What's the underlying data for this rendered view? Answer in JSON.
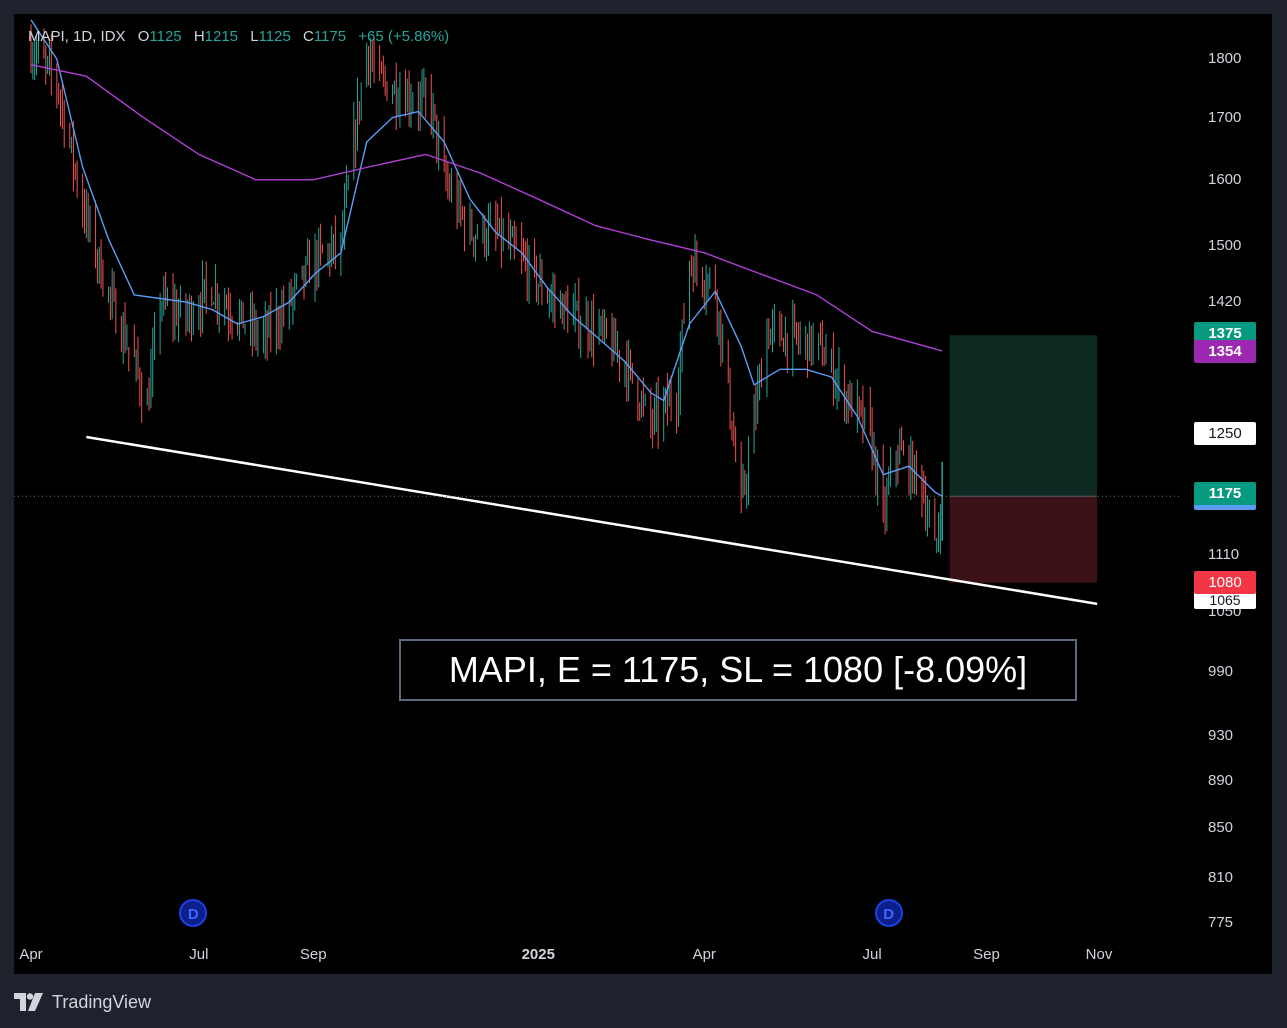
{
  "legend": {
    "symbol": "MAPI, 1D, IDX",
    "open_label": "O",
    "open": "1125",
    "high_label": "H",
    "high": "1215",
    "low_label": "L",
    "low": "1125",
    "close_label": "C",
    "close": "1175",
    "change": "+65 (+5.86%)"
  },
  "note": "MAPI, E = 1175, SL = 1080 [-8.09%]",
  "footer": {
    "brand": "TradingView",
    "logo_icon": "tradingview-logo-icon"
  },
  "colors": {
    "background": "#000000",
    "frame": "#1e222d",
    "up": "#26a69a",
    "down": "#ef5350",
    "ma_fast": "#5b9cf6",
    "ma_slow": "#b03fd6",
    "target_zone": "#0c2a22",
    "stop_zone": "#3a1117"
  },
  "price_tags": {
    "t1375": "1375",
    "t1354": "1354",
    "t1250": "1250",
    "t1175": "1175",
    "t1080": "1080",
    "t1065": "1065"
  },
  "dividend_markers": [
    {
      "label": "D",
      "date": "2024-06-28"
    },
    {
      "label": "D",
      "date": "2025-07-10"
    }
  ],
  "chart_data": {
    "type": "candlestick",
    "symbol": "MAPI",
    "timeframe": "1D",
    "exchange": "IDX",
    "title": "",
    "xlabel": "",
    "ylabel": "",
    "y_scale": "log",
    "ylim": [
      750,
      1900
    ],
    "y_ticks": [
      775,
      810,
      850,
      890,
      930,
      990,
      1050,
      1110,
      1185,
      1250,
      1345,
      1420,
      1500,
      1600,
      1700,
      1800
    ],
    "x_ticks": [
      {
        "label": "Apr",
        "date": "2024-04-01"
      },
      {
        "label": "Jul",
        "date": "2024-07-01"
      },
      {
        "label": "Sep",
        "date": "2024-09-01"
      },
      {
        "label": "2025",
        "date": "2025-01-01"
      },
      {
        "label": "Apr",
        "date": "2025-04-01"
      },
      {
        "label": "Jul",
        "date": "2025-07-01"
      },
      {
        "label": "Sep",
        "date": "2025-09-01"
      },
      {
        "label": "Nov",
        "date": "2025-11-01"
      }
    ],
    "xlim": [
      "2024-04-01",
      "2025-11-20"
    ],
    "last_bar": {
      "date": "2025-08-08",
      "open": 1125,
      "high": 1215,
      "low": 1125,
      "close": 1175
    },
    "price_path": [
      [
        "2024-04-01",
        1820
      ],
      [
        "2024-04-15",
        1760
      ],
      [
        "2024-04-29",
        1560
      ],
      [
        "2024-05-13",
        1430
      ],
      [
        "2024-05-27",
        1340
      ],
      [
        "2024-06-03",
        1280
      ],
      [
        "2024-06-10",
        1420
      ],
      [
        "2024-06-24",
        1400
      ],
      [
        "2024-07-08",
        1440
      ],
      [
        "2024-07-22",
        1400
      ],
      [
        "2024-08-05",
        1370
      ],
      [
        "2024-08-19",
        1420
      ],
      [
        "2024-09-02",
        1480
      ],
      [
        "2024-09-16",
        1500
      ],
      [
        "2024-09-23",
        1660
      ],
      [
        "2024-09-30",
        1820
      ],
      [
        "2024-10-07",
        1760
      ],
      [
        "2024-10-21",
        1740
      ],
      [
        "2024-11-04",
        1720
      ],
      [
        "2024-11-11",
        1600
      ],
      [
        "2024-11-25",
        1520
      ],
      [
        "2024-12-09",
        1520
      ],
      [
        "2024-12-23",
        1480
      ],
      [
        "2025-01-06",
        1430
      ],
      [
        "2025-01-20",
        1400
      ],
      [
        "2025-02-03",
        1380
      ],
      [
        "2025-02-17",
        1340
      ],
      [
        "2025-03-03",
        1260
      ],
      [
        "2025-03-17",
        1300
      ],
      [
        "2025-03-24",
        1480
      ],
      [
        "2025-04-07",
        1440
      ],
      [
        "2025-04-14",
        1300
      ],
      [
        "2025-04-21",
        1160
      ],
      [
        "2025-05-05",
        1380
      ],
      [
        "2025-05-19",
        1370
      ],
      [
        "2025-06-02",
        1360
      ],
      [
        "2025-06-16",
        1300
      ],
      [
        "2025-06-30",
        1250
      ],
      [
        "2025-07-07",
        1150
      ],
      [
        "2025-07-14",
        1230
      ],
      [
        "2025-07-28",
        1190
      ],
      [
        "2025-08-04",
        1110
      ],
      [
        "2025-08-08",
        1175
      ]
    ],
    "series": [
      {
        "kind": "moving_average_fast",
        "values": [
          [
            "2024-04-01",
            1870
          ],
          [
            "2024-04-15",
            1800
          ],
          [
            "2024-04-29",
            1620
          ],
          [
            "2024-05-13",
            1510
          ],
          [
            "2024-05-27",
            1430
          ],
          [
            "2024-06-10",
            1425
          ],
          [
            "2024-06-24",
            1420
          ],
          [
            "2024-07-08",
            1410
          ],
          [
            "2024-07-22",
            1390
          ],
          [
            "2024-08-05",
            1400
          ],
          [
            "2024-08-19",
            1420
          ],
          [
            "2024-09-02",
            1460
          ],
          [
            "2024-09-16",
            1490
          ],
          [
            "2024-09-30",
            1660
          ],
          [
            "2024-10-14",
            1700
          ],
          [
            "2024-10-28",
            1710
          ],
          [
            "2024-11-11",
            1660
          ],
          [
            "2024-11-25",
            1570
          ],
          [
            "2024-12-09",
            1520
          ],
          [
            "2024-12-23",
            1490
          ],
          [
            "2025-01-06",
            1440
          ],
          [
            "2025-01-20",
            1400
          ],
          [
            "2025-02-03",
            1370
          ],
          [
            "2025-02-17",
            1340
          ],
          [
            "2025-03-03",
            1300
          ],
          [
            "2025-03-10",
            1290
          ],
          [
            "2025-03-24",
            1390
          ],
          [
            "2025-04-07",
            1435
          ],
          [
            "2025-04-21",
            1360
          ],
          [
            "2025-04-28",
            1310
          ],
          [
            "2025-05-12",
            1330
          ],
          [
            "2025-05-26",
            1330
          ],
          [
            "2025-06-09",
            1320
          ],
          [
            "2025-06-23",
            1270
          ],
          [
            "2025-07-07",
            1200
          ],
          [
            "2025-07-21",
            1210
          ],
          [
            "2025-08-04",
            1180
          ],
          [
            "2025-08-08",
            1175
          ]
        ]
      },
      {
        "kind": "moving_average_slow",
        "values": [
          [
            "2024-04-01",
            1790
          ],
          [
            "2024-05-01",
            1770
          ],
          [
            "2024-06-01",
            1700
          ],
          [
            "2024-07-01",
            1640
          ],
          [
            "2024-08-01",
            1600
          ],
          [
            "2024-09-01",
            1600
          ],
          [
            "2024-10-01",
            1620
          ],
          [
            "2024-11-01",
            1640
          ],
          [
            "2024-12-01",
            1610
          ],
          [
            "2025-01-01",
            1570
          ],
          [
            "2025-02-01",
            1530
          ],
          [
            "2025-03-01",
            1510
          ],
          [
            "2025-04-01",
            1490
          ],
          [
            "2025-05-01",
            1460
          ],
          [
            "2025-06-01",
            1430
          ],
          [
            "2025-07-01",
            1380
          ],
          [
            "2025-08-08",
            1354
          ]
        ]
      }
    ],
    "trendline": {
      "start": [
        "2024-05-01",
        1245
      ],
      "end": [
        "2025-10-31",
        1058
      ],
      "color": "#ffffff"
    },
    "position": {
      "entry": 1175,
      "target": 1375,
      "stop": 1080,
      "start": "2025-08-12",
      "end": "2025-10-31"
    },
    "current_price": 1175
  }
}
